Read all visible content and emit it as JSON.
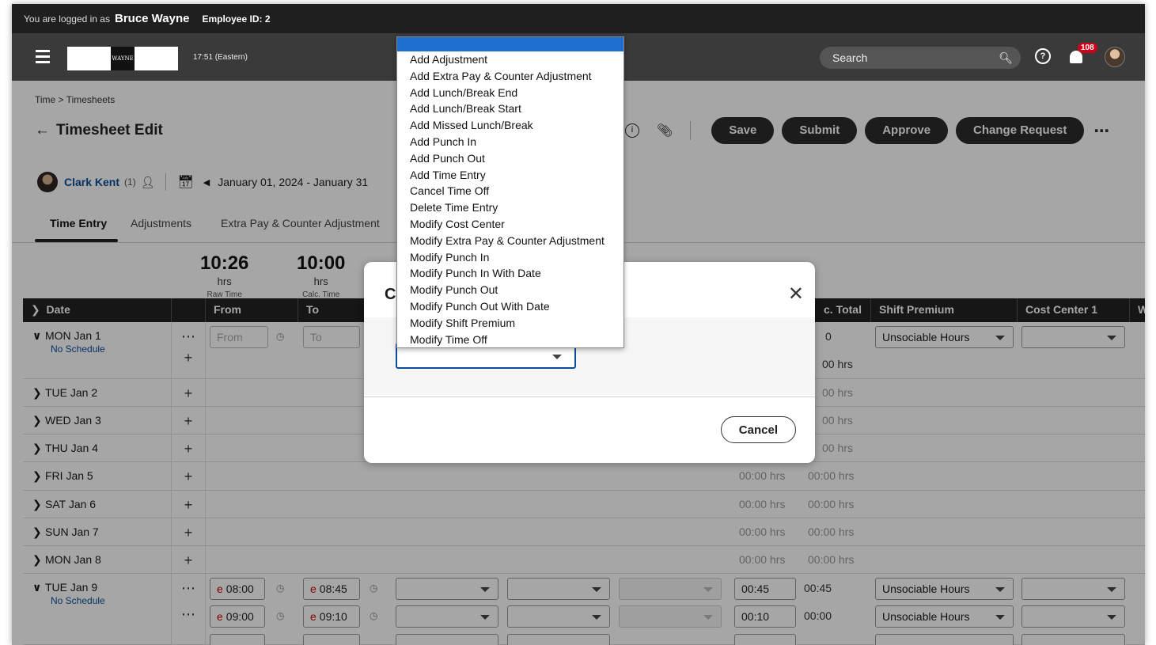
{
  "user_bar": {
    "prefix": "You are logged in as",
    "name": "Bruce Wayne",
    "employee": "Employee ID: 2"
  },
  "nav": {
    "clock": "17:51 (Eastern)",
    "search_placeholder": "Search",
    "notifications": "108",
    "logo_text": "WAYNE"
  },
  "breadcrumb": "Time > Timesheets",
  "page_title": "Timesheet Edit",
  "actions": {
    "save": "Save",
    "submit": "Submit",
    "approve": "Approve",
    "change_request": "Change Request"
  },
  "employee": {
    "name": "Clark Kent",
    "count": "(1)",
    "date_range": "January 01, 2024 - January 31"
  },
  "tabs": [
    "Time Entry",
    "Adjustments",
    "Extra Pay & Counter Adjustment"
  ],
  "totals": [
    {
      "value": "10:26",
      "unit": "hrs",
      "label": "Raw Time"
    },
    {
      "value": "10:00",
      "unit": "hrs",
      "label": "Calc. Time"
    }
  ],
  "table": {
    "headers": {
      "date": "Date",
      "from": "From",
      "to": "To",
      "calc_total": "c. Total",
      "shift_premium": "Shift Premium",
      "cost_center": "Cost Center 1",
      "w": "W"
    },
    "rows": [
      {
        "day": "MON Jan 1",
        "sub": "No Schedule",
        "from": "From",
        "to": "To",
        "calc": "0",
        "shift": "Unsociable Hours",
        "total2": "00 hrs"
      },
      {
        "day": "TUE Jan 2",
        "calc": "00 hrs"
      },
      {
        "day": "WED Jan 3",
        "calc": "00 hrs"
      },
      {
        "day": "THU Jan 4",
        "calc": "00 hrs"
      },
      {
        "day": "FRI Jan 5",
        "raw": "00:00 hrs",
        "calc": "00:00 hrs"
      },
      {
        "day": "SAT Jan 6",
        "raw": "00:00 hrs",
        "calc": "00:00 hrs"
      },
      {
        "day": "SUN Jan 7",
        "raw": "00:00 hrs",
        "calc": "00:00 hrs"
      },
      {
        "day": "MON Jan 8",
        "raw": "00:00 hrs",
        "calc": "00:00 hrs"
      },
      {
        "day": "TUE Jan 9",
        "sub": "No Schedule",
        "p1": {
          "from": "08:00",
          "to": "08:45",
          "raw": "00:45",
          "calc": "00:45",
          "shift": "Unsociable Hours"
        },
        "p2": {
          "from": "09:00",
          "to": "09:10",
          "raw": "00:10",
          "calc": "00:00",
          "shift": "Unsociable Hours"
        }
      }
    ]
  },
  "modal": {
    "title": "C",
    "cancel": "Cancel"
  },
  "dropdown_options": [
    "Add Adjustment",
    "Add Extra Pay & Counter Adjustment",
    "Add Lunch/Break End",
    "Add Lunch/Break Start",
    "Add Missed Lunch/Break",
    "Add Punch In",
    "Add Punch Out",
    "Add Time Entry",
    "Cancel Time Off",
    "Delete Time Entry",
    "Modify Cost Center",
    "Modify Extra Pay & Counter Adjustment",
    "Modify Punch In",
    "Modify Punch In With Date",
    "Modify Punch Out",
    "Modify Punch Out With Date",
    "Modify Shift Premium",
    "Modify Time Off"
  ],
  "colors": {
    "accent": "#0a4f9c",
    "highlight": "#1f6fd1",
    "badge": "#d0021b",
    "dark": "#232323"
  }
}
